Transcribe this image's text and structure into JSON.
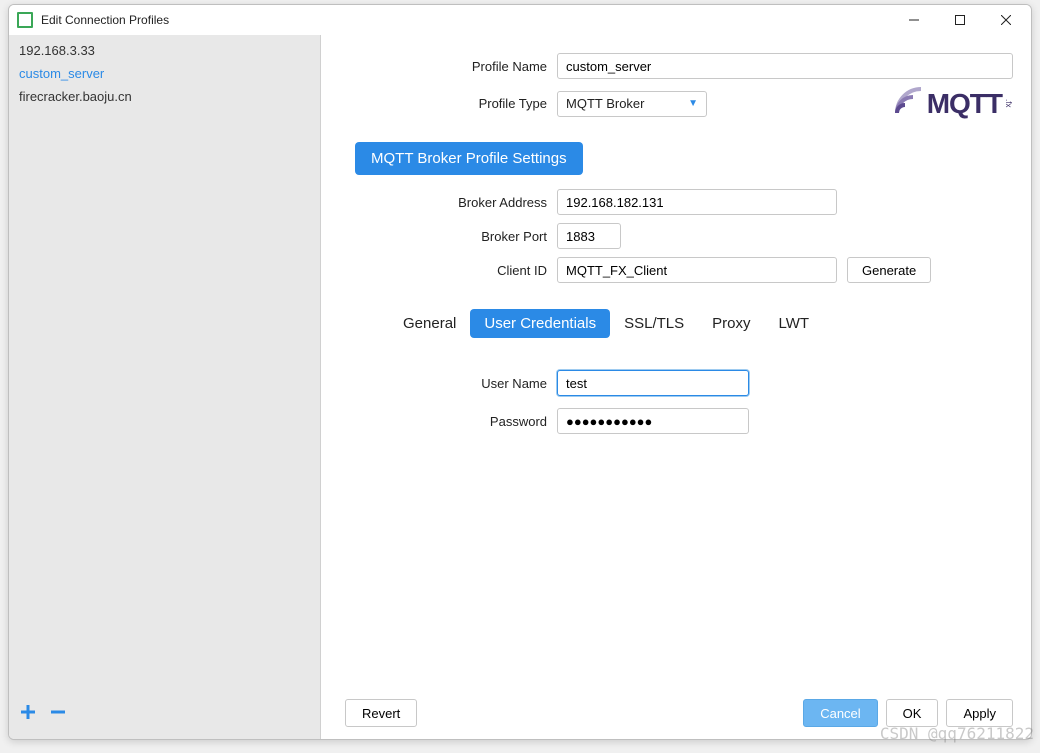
{
  "window": {
    "title": "Edit Connection Profiles"
  },
  "sidebar": {
    "profiles": [
      {
        "name": "192.168.3.33",
        "selected": false
      },
      {
        "name": "custom_server",
        "selected": true
      },
      {
        "name": "firecracker.baoju.cn",
        "selected": false
      }
    ]
  },
  "form": {
    "profile_name_label": "Profile Name",
    "profile_name_value": "custom_server",
    "profile_type_label": "Profile Type",
    "profile_type_value": "MQTT Broker",
    "section_header": "MQTT Broker Profile Settings",
    "broker_address_label": "Broker Address",
    "broker_address_value": "192.168.182.131",
    "broker_port_label": "Broker Port",
    "broker_port_value": "1883",
    "client_id_label": "Client ID",
    "client_id_value": "MQTT_FX_Client",
    "generate_label": "Generate"
  },
  "subtabs": {
    "items": [
      "General",
      "User Credentials",
      "SSL/TLS",
      "Proxy",
      "LWT"
    ],
    "active_index": 1
  },
  "credentials": {
    "username_label": "User Name",
    "username_value": "test",
    "password_label": "Password",
    "password_value": "●●●●●●●●●●●"
  },
  "footer": {
    "revert": "Revert",
    "cancel": "Cancel",
    "ok": "OK",
    "apply": "Apply"
  },
  "logo": {
    "text": "MQTT",
    "suffix": ".fx"
  },
  "watermark": "CSDN @qq76211822"
}
